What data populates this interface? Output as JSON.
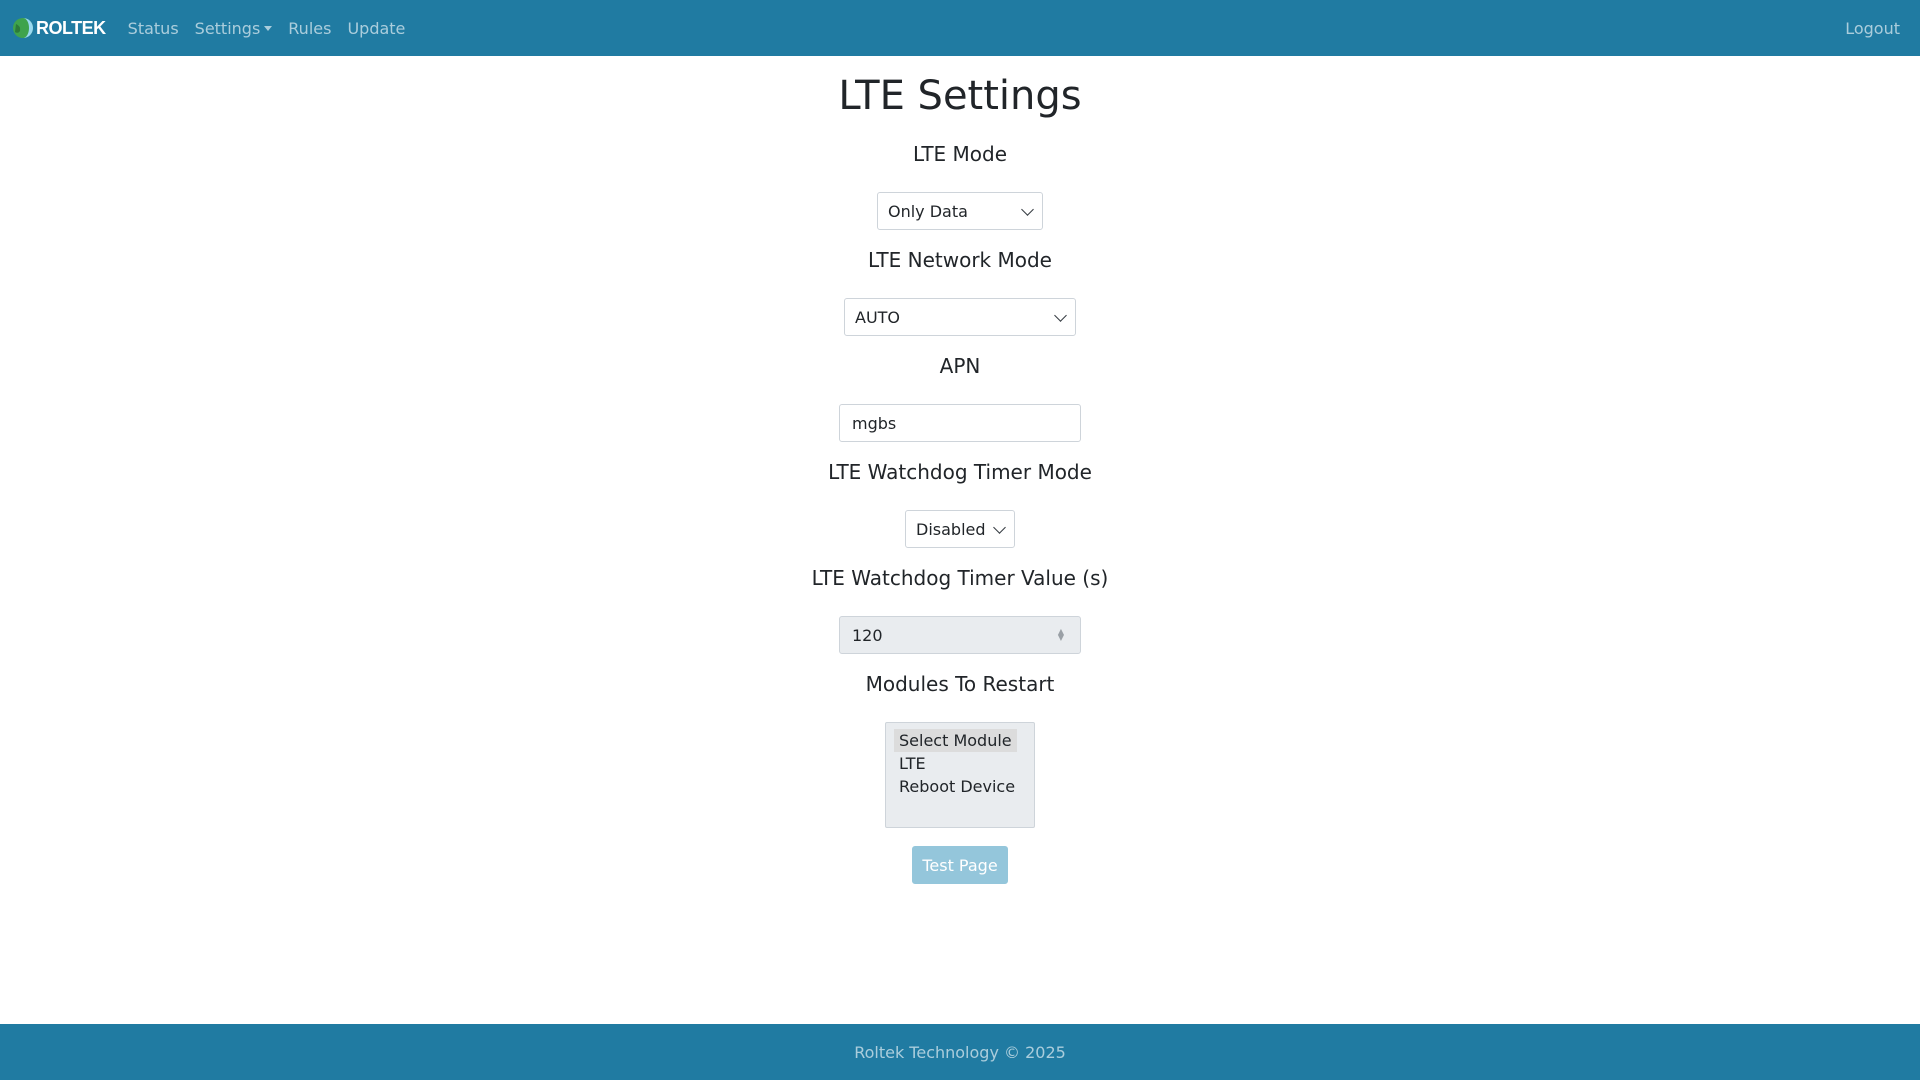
{
  "navbar": {
    "brand": "ROLTEK",
    "links": [
      "Status",
      "Settings",
      "Rules",
      "Update"
    ],
    "logout": "Logout"
  },
  "page": {
    "title": "LTE Settings"
  },
  "lte_mode": {
    "label": "LTE Mode",
    "selected": "Only Data"
  },
  "network_mode": {
    "label": "LTE Network Mode",
    "selected": "AUTO"
  },
  "apn": {
    "label": "APN",
    "value": "mgbs"
  },
  "watchdog_mode": {
    "label": "LTE Watchdog Timer Mode",
    "selected": "Disabled"
  },
  "watchdog_value": {
    "label": "LTE Watchdog Timer Value (s)",
    "value": "120"
  },
  "modules": {
    "label": "Modules To Restart",
    "options": [
      "Select Module",
      "LTE",
      "Reboot Device"
    ]
  },
  "test_button": {
    "label": "Test Page"
  },
  "footer": {
    "text": "Roltek Technology © 2025"
  },
  "colors": {
    "navbar": "#207ba2",
    "button_disabled": "#94c6db"
  }
}
